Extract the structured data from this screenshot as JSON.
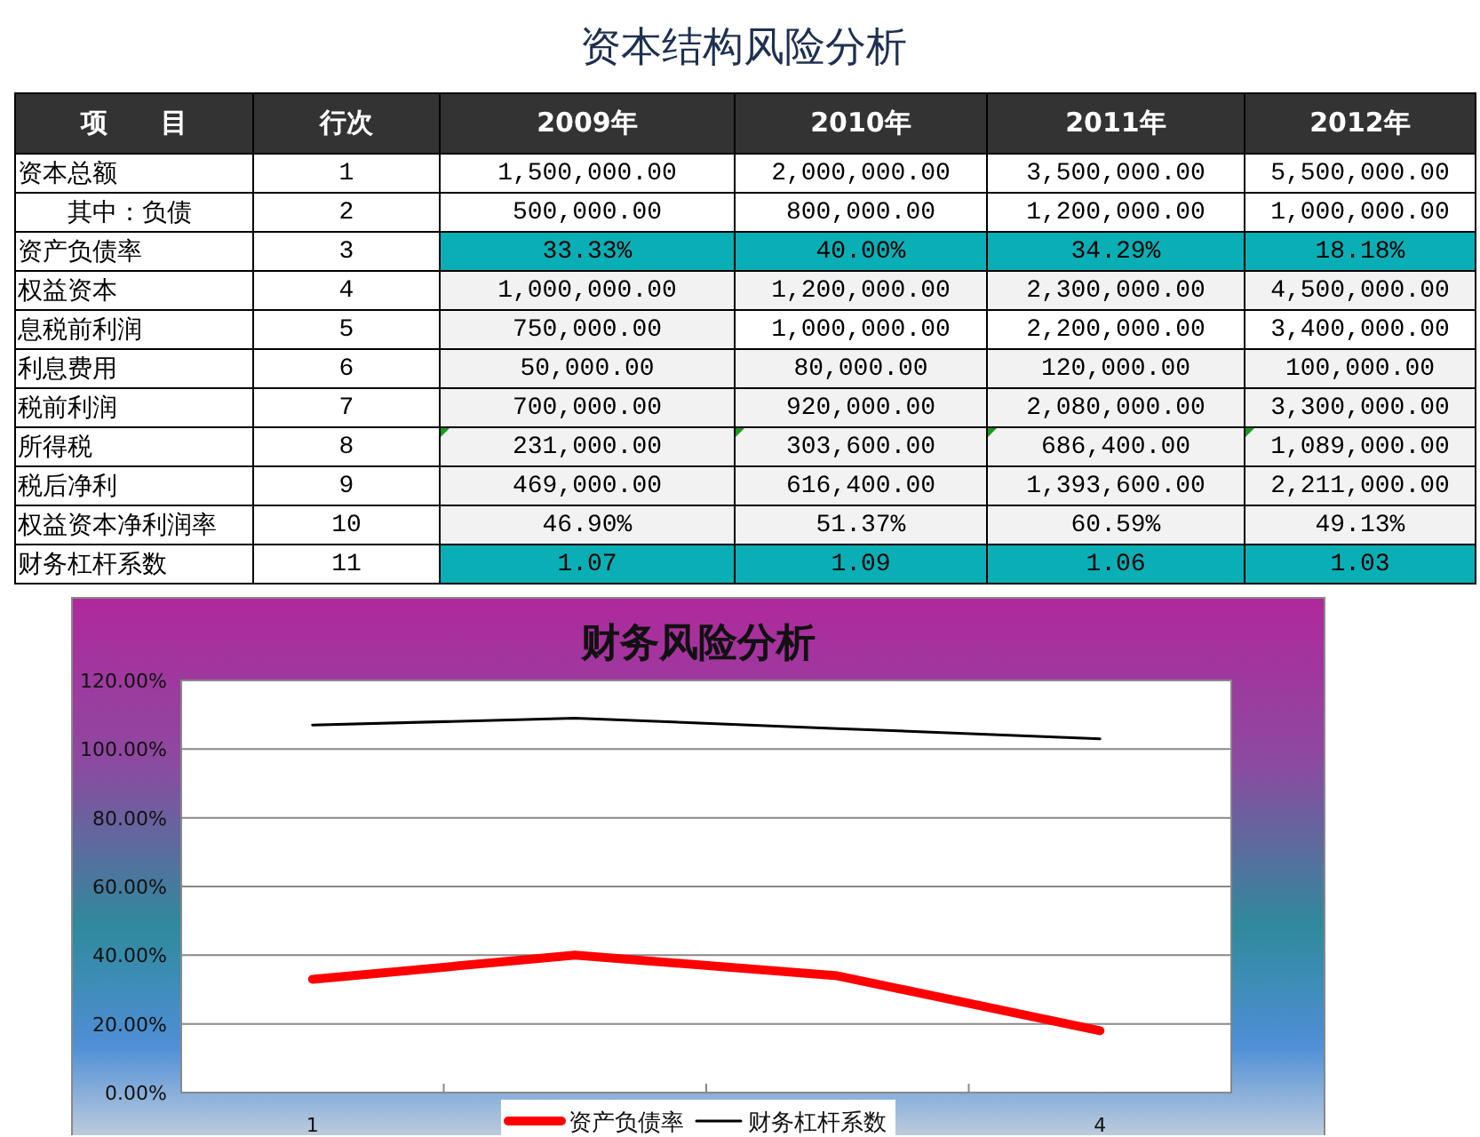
{
  "title": "资本结构风险分析",
  "table": {
    "columns": [
      "项　　目",
      "行次",
      "2009年",
      "2010年",
      "2011年",
      "2012年"
    ],
    "rows": [
      {
        "flagged": false,
        "cells": [
          {
            "text": "资本总额",
            "kind": "plain"
          },
          {
            "text": "1",
            "kind": "plain"
          },
          {
            "text": "1,500,000.00",
            "kind": "plain"
          },
          {
            "text": "2,000,000.00",
            "kind": "plain"
          },
          {
            "text": "3,500,000.00",
            "kind": "plain"
          },
          {
            "text": "5,500,000.00",
            "kind": "plain"
          }
        ]
      },
      {
        "flagged": false,
        "cells": [
          {
            "text": "　　其中：负债",
            "kind": "plain"
          },
          {
            "text": "2",
            "kind": "plain"
          },
          {
            "text": "500,000.00",
            "kind": "plain"
          },
          {
            "text": "800,000.00",
            "kind": "plain"
          },
          {
            "text": "1,200,000.00",
            "kind": "plain"
          },
          {
            "text": "1,000,000.00",
            "kind": "plain"
          }
        ]
      },
      {
        "flagged": false,
        "cells": [
          {
            "text": "资产负债率",
            "kind": "plain"
          },
          {
            "text": "3",
            "kind": "plain"
          },
          {
            "text": "33.33%",
            "kind": "highlight"
          },
          {
            "text": "40.00%",
            "kind": "highlight"
          },
          {
            "text": "34.29%",
            "kind": "highlight"
          },
          {
            "text": "18.18%",
            "kind": "highlight"
          }
        ]
      },
      {
        "flagged": false,
        "cells": [
          {
            "text": "权益资本",
            "kind": "plain"
          },
          {
            "text": "4",
            "kind": "plain"
          },
          {
            "text": "1,000,000.00",
            "kind": "shaded"
          },
          {
            "text": "1,200,000.00",
            "kind": "shaded"
          },
          {
            "text": "2,300,000.00",
            "kind": "shaded"
          },
          {
            "text": "4,500,000.00",
            "kind": "shaded"
          }
        ]
      },
      {
        "flagged": false,
        "cells": [
          {
            "text": "息税前利润",
            "kind": "plain"
          },
          {
            "text": "5",
            "kind": "plain"
          },
          {
            "text": "750,000.00",
            "kind": "shaded"
          },
          {
            "text": "1,000,000.00",
            "kind": "plain"
          },
          {
            "text": "2,200,000.00",
            "kind": "plain"
          },
          {
            "text": "3,400,000.00",
            "kind": "plain"
          }
        ]
      },
      {
        "flagged": false,
        "cells": [
          {
            "text": "利息费用",
            "kind": "plain"
          },
          {
            "text": "6",
            "kind": "plain"
          },
          {
            "text": "50,000.00",
            "kind": "shaded"
          },
          {
            "text": "80,000.00",
            "kind": "shaded"
          },
          {
            "text": "120,000.00",
            "kind": "shaded"
          },
          {
            "text": "100,000.00",
            "kind": "shaded"
          }
        ]
      },
      {
        "flagged": false,
        "cells": [
          {
            "text": "税前利润",
            "kind": "plain"
          },
          {
            "text": "7",
            "kind": "plain"
          },
          {
            "text": "700,000.00",
            "kind": "shaded"
          },
          {
            "text": "920,000.00",
            "kind": "shaded"
          },
          {
            "text": "2,080,000.00",
            "kind": "shaded"
          },
          {
            "text": "3,300,000.00",
            "kind": "shaded"
          }
        ]
      },
      {
        "flagged": true,
        "cells": [
          {
            "text": "所得税",
            "kind": "plain"
          },
          {
            "text": "8",
            "kind": "plain"
          },
          {
            "text": "231,000.00",
            "kind": "shaded"
          },
          {
            "text": "303,600.00",
            "kind": "shaded"
          },
          {
            "text": "686,400.00",
            "kind": "shaded"
          },
          {
            "text": "1,089,000.00",
            "kind": "shaded"
          }
        ]
      },
      {
        "flagged": false,
        "cells": [
          {
            "text": "税后净利",
            "kind": "plain"
          },
          {
            "text": "9",
            "kind": "plain"
          },
          {
            "text": "469,000.00",
            "kind": "shaded"
          },
          {
            "text": "616,400.00",
            "kind": "shaded"
          },
          {
            "text": "1,393,600.00",
            "kind": "shaded"
          },
          {
            "text": "2,211,000.00",
            "kind": "shaded"
          }
        ]
      },
      {
        "flagged": false,
        "cells": [
          {
            "text": "权益资本净利润率",
            "kind": "plain"
          },
          {
            "text": "10",
            "kind": "plain"
          },
          {
            "text": "46.90%",
            "kind": "shaded"
          },
          {
            "text": "51.37%",
            "kind": "shaded"
          },
          {
            "text": "60.59%",
            "kind": "shaded"
          },
          {
            "text": "49.13%",
            "kind": "shaded"
          }
        ]
      },
      {
        "flagged": false,
        "cells": [
          {
            "text": "财务杠杆系数",
            "kind": "plain"
          },
          {
            "text": "11",
            "kind": "plain"
          },
          {
            "text": "1.07",
            "kind": "highlight"
          },
          {
            "text": "1.09",
            "kind": "highlight"
          },
          {
            "text": "1.06",
            "kind": "highlight"
          },
          {
            "text": "1.03",
            "kind": "highlight"
          }
        ]
      }
    ]
  },
  "chart": {
    "chart_data": {
      "type": "line",
      "title": "财务风险分析",
      "x": [
        1,
        2,
        3,
        4
      ],
      "series": [
        {
          "name": "资产负债率",
          "color": "#ff0000",
          "values": [
            33,
            40,
            34,
            18
          ]
        },
        {
          "name": "财务杠杆系数",
          "color": "#000000",
          "values": [
            107,
            109,
            106,
            103
          ]
        }
      ],
      "xlim": [
        0.5,
        4.5
      ],
      "ylim": [
        0,
        120
      ],
      "yticks": [
        {
          "value": 0,
          "label": "0.00%"
        },
        {
          "value": 20,
          "label": "20.00%"
        },
        {
          "value": 40,
          "label": "40.00%"
        },
        {
          "value": 60,
          "label": "60.00%"
        },
        {
          "value": 80,
          "label": "80.00%"
        },
        {
          "value": 100,
          "label": "100.00%"
        },
        {
          "value": 120,
          "label": "120.00%"
        }
      ],
      "xticks": [
        {
          "value": 1,
          "label": "1"
        },
        {
          "value": 4,
          "label": "4"
        }
      ],
      "grid": true,
      "legend": true
    }
  }
}
